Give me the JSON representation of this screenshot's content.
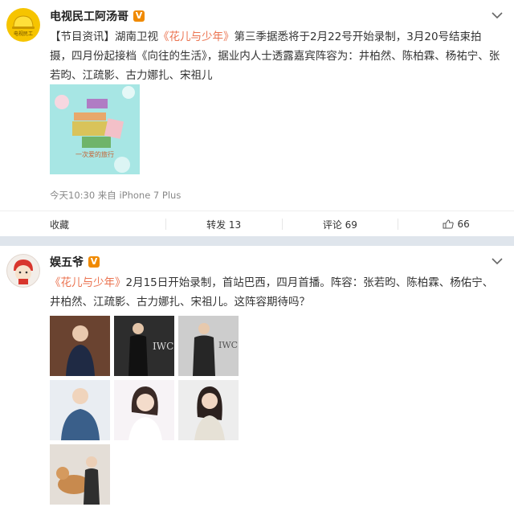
{
  "post1": {
    "author": "电视民工阿汤哥",
    "badge": "V",
    "avatar_text": "电视民工",
    "text_prefix": "【节目资讯】湖南卫视",
    "text_link": "《花儿与少年》",
    "text_rest": "第三季据悉将于2月22号开始录制，3月20号结束拍摄，四月份起接档《向往的生活》，据业内人士透露嘉宾阵容为：井柏然、陈柏霖、杨祐宁、张若昀、江疏影、古力娜扎、宋祖儿",
    "image_caption": "一次爱的旅行",
    "meta": "今天10:30 来自 iPhone 7 Plus",
    "actions": {
      "collect": "收藏",
      "repost": "转发 13",
      "comment": "评论 69",
      "like": "66"
    }
  },
  "post2": {
    "author": "娱五爷",
    "badge": "V",
    "text_link": "《花儿与少年》",
    "text_rest": "2月15日开始录制，首站巴西，四月首播。阵容：张若昀、陈柏霖、杨佑宁、井柏然、江疏影、古力娜扎、宋祖儿。这阵容期待吗？",
    "photos": [
      {
        "label": "",
        "name": "photo-1"
      },
      {
        "label": "IWC",
        "name": "photo-2"
      },
      {
        "label": "IWC",
        "name": "photo-3"
      },
      {
        "label": "",
        "name": "photo-4"
      },
      {
        "label": "",
        "name": "photo-5"
      },
      {
        "label": "",
        "name": "photo-6"
      },
      {
        "label": "",
        "name": "photo-7"
      }
    ]
  },
  "colors": {
    "accent": "#eb7350",
    "badge": "#f08a00",
    "separator": "#dfe5ec"
  }
}
